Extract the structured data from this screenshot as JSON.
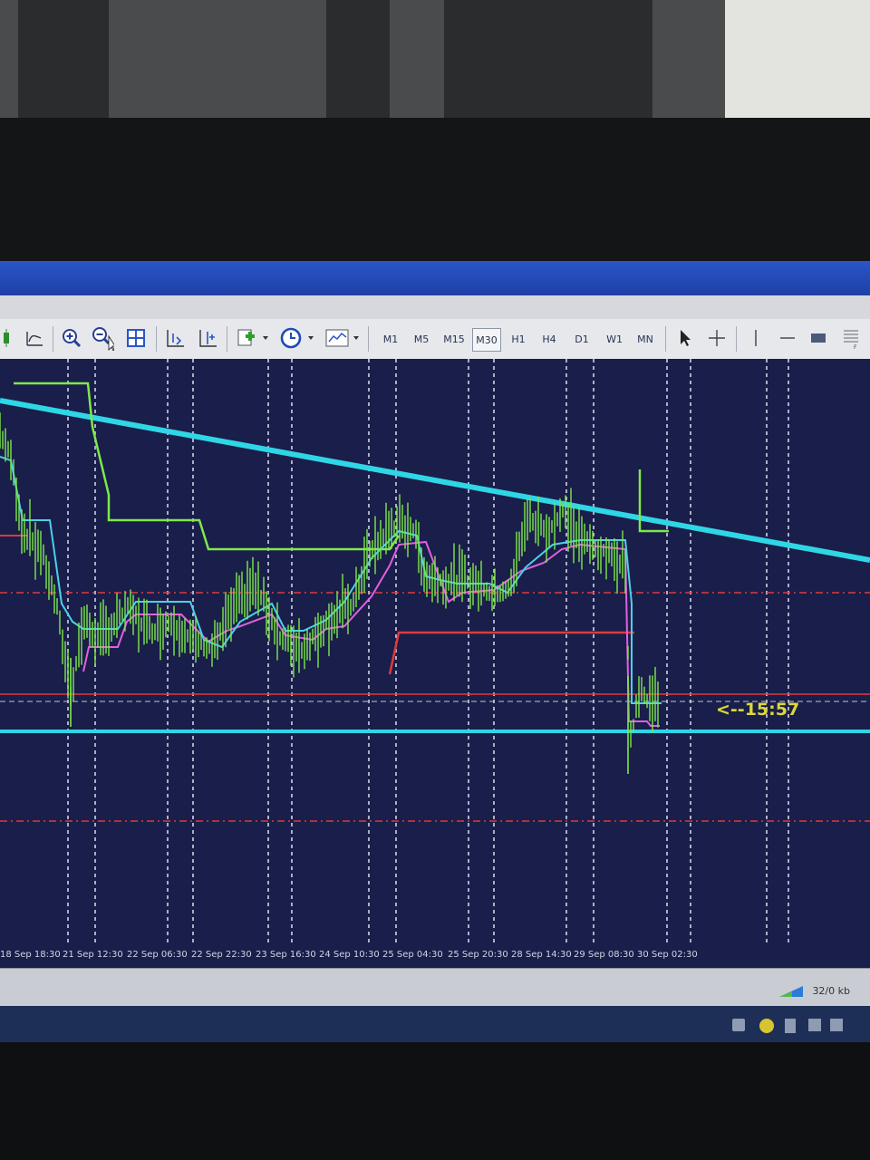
{
  "toolbar": {
    "timeframes": [
      "M1",
      "M5",
      "M15",
      "M30",
      "H1",
      "H4",
      "D1",
      "W1",
      "MN"
    ],
    "active_timeframe": "M30"
  },
  "chart": {
    "background": "#1a1e4a",
    "price_color": "#7ee84a",
    "trendline_color": "#2fd6e6",
    "countdown": "<--15:57",
    "time_axis": [
      "18 Sep 18:30",
      "21 Sep 12:30",
      "22 Sep 06:30",
      "22 Sep 22:30",
      "23 Sep 16:30",
      "24 Sep 10:30",
      "25 Sep 04:30",
      "25 Sep 20:30",
      "28 Sep 14:30",
      "29 Sep 08:30",
      "30 Sep 02:30"
    ]
  },
  "status": {
    "traffic": "32/0 kb"
  }
}
